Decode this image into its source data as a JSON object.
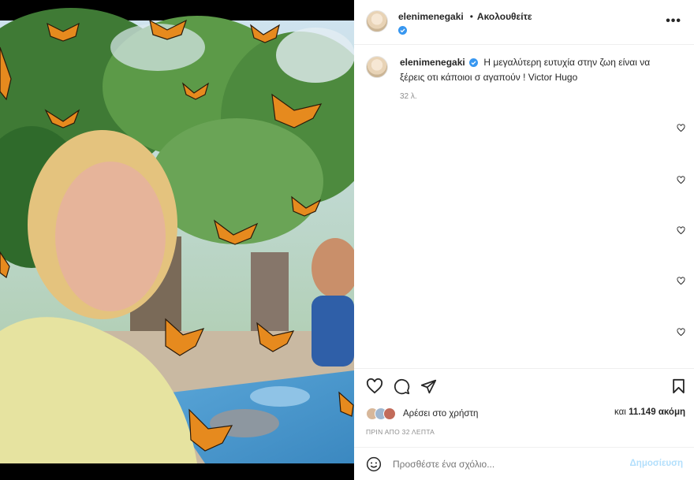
{
  "header": {
    "username": "elenimenegaki",
    "separator": "•",
    "follow_label": "Ακολουθείτε",
    "more_label": "•••"
  },
  "caption": {
    "username": "elenimenegaki",
    "text": "Η μεγαλύτερη ευτυχία στην ζωη είναι να ξέρεις οτι κάποιοι σ αγαπούν ! Victor Hugo",
    "time": "32 λ."
  },
  "likes": {
    "text": "Αρέσει στο χρήστη",
    "prefix": "και",
    "count": "11.149",
    "suffix": "ακόμη"
  },
  "posted_time": "ΠΡΙΝ ΑΠΟ 32 ΛΕΠΤΑ",
  "comment": {
    "placeholder": "Προσθέστε ένα σχόλιο...",
    "publish_label": "Δημοσίευση"
  },
  "colors": {
    "verified": "#3897f0",
    "publish": "#b2dffc",
    "secondary_text": "#8e8e8e"
  },
  "icons": [
    "verified-badge-icon",
    "more-icon",
    "heart-icon",
    "comment-icon",
    "share-icon",
    "bookmark-icon",
    "emoji-icon"
  ]
}
